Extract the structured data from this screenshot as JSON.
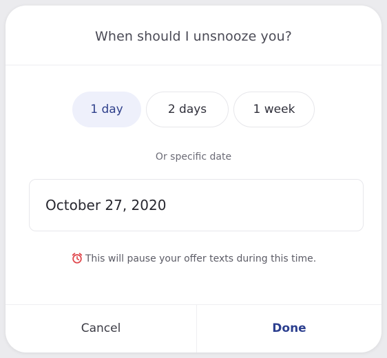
{
  "dialog": {
    "title": "When should I unsnooze you?",
    "durations": [
      {
        "label": "1 day",
        "selected": true
      },
      {
        "label": "2 days",
        "selected": false
      },
      {
        "label": "1 week",
        "selected": false
      }
    ],
    "or_text": "Or specific date",
    "date_value": "October 27, 2020",
    "notice_icon": "alarm-clock-icon",
    "notice_text": "This will pause your offer texts during this time.",
    "cancel_label": "Cancel",
    "done_label": "Done"
  },
  "colors": {
    "accent": "#2c3f8f",
    "selected_chip_bg": "#eef0fb",
    "alarm_red": "#e0474c"
  }
}
